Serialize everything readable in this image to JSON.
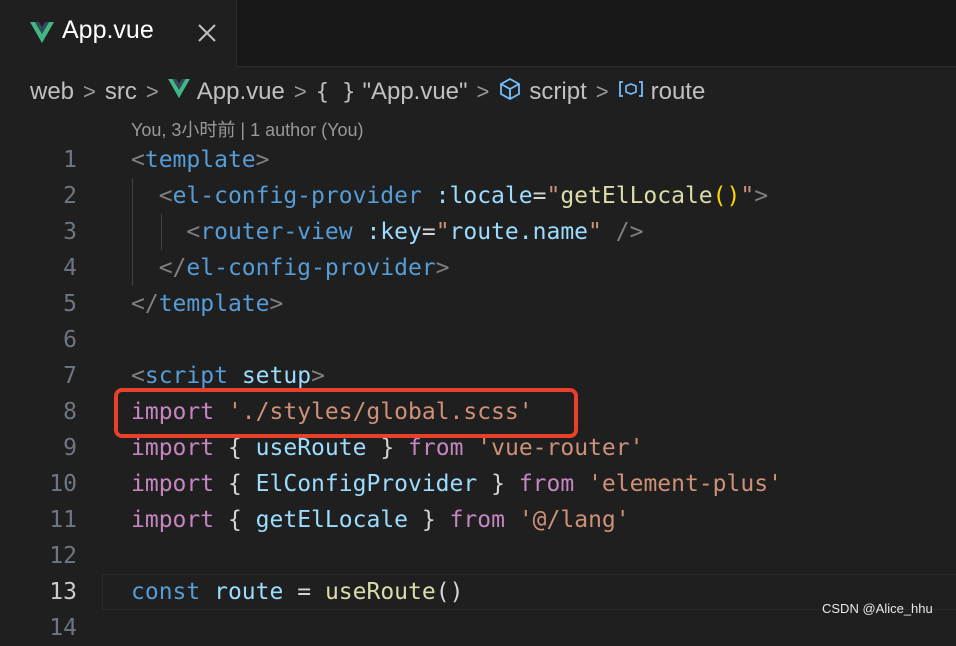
{
  "tab": {
    "label": "App.vue",
    "icon": "vue-icon",
    "close_icon": "close-icon"
  },
  "breadcrumb": {
    "items": [
      "web",
      "src",
      "App.vue",
      "\"App.vue\"",
      "script",
      "route"
    ],
    "braces": "{ }",
    "separator": ">"
  },
  "codelens": "You, 3小时前 | 1 author (You)",
  "editor": {
    "line_numbers": [
      "1",
      "2",
      "3",
      "4",
      "5",
      "6",
      "7",
      "8",
      "9",
      "10",
      "11",
      "12",
      "13",
      "14"
    ],
    "active_line": "13",
    "tokens": {
      "l1": [
        "<",
        "template",
        ">"
      ],
      "l2": [
        "<",
        "el-config-provider",
        ":locale",
        "=",
        "\"",
        "getElLocale",
        "()",
        "\"",
        ">"
      ],
      "l3": [
        "<",
        "router-view",
        ":key",
        "=",
        "\"",
        "route.name",
        "\"",
        " />"
      ],
      "l4": [
        "</",
        "el-config-provider",
        ">"
      ],
      "l5": [
        "</",
        "template",
        ">"
      ],
      "l7": [
        "<",
        "script",
        "setup",
        ">"
      ],
      "l8": [
        "import",
        "'./styles/global.scss'"
      ],
      "l9": [
        "import",
        "{",
        "useRoute",
        "}",
        "from",
        "'vue-router'"
      ],
      "l10": [
        "import",
        "{",
        "ElConfigProvider",
        "}",
        "from",
        "'element-plus'"
      ],
      "l11": [
        "import",
        "{",
        "getElLocale",
        "}",
        "from",
        "'@/lang'"
      ],
      "l13": [
        "const",
        "route",
        "=",
        "useRoute",
        "()"
      ]
    }
  },
  "watermark": "CSDN @Alice_hhu",
  "colors": {
    "highlight_box": "#e8402a",
    "vue_green": "#41b883",
    "tag": "#569cd6",
    "string": "#ce9178",
    "keyword": "#c586c0"
  }
}
